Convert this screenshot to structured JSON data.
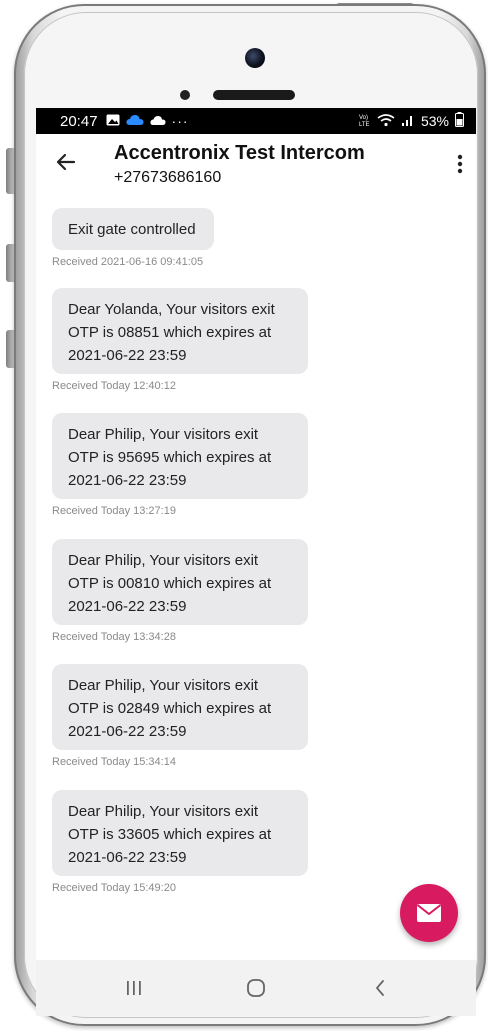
{
  "status_bar": {
    "time": "20:47",
    "battery": "53%",
    "left_icons": [
      "gallery-icon",
      "cloud-icon",
      "cloud-upload-icon",
      "more-icon"
    ],
    "right_icons": [
      "volte-icon",
      "wifi-icon",
      "signal-icon",
      "battery-icon"
    ],
    "volte_label": "Vo) LTE"
  },
  "header": {
    "title": "Accentronix Test Intercom",
    "phone_number": "+27673686160"
  },
  "messages": [
    {
      "lines": [
        "Exit gate controlled"
      ],
      "meta": "Received 2021-06-16 09:41:05"
    },
    {
      "lines": [
        "Dear Yolanda, Your visitors exit",
        "OTP is 08851 which expires at",
        "2021-06-22 23:59"
      ],
      "meta": "Received Today 12:40:12"
    },
    {
      "lines": [
        "Dear Philip, Your visitors exit",
        "OTP is 95695 which expires at",
        "2021-06-22 23:59"
      ],
      "meta": "Received Today 13:27:19"
    },
    {
      "lines": [
        "Dear Philip, Your visitors exit",
        "OTP is 00810 which expires at",
        "2021-06-22 23:59"
      ],
      "meta": "Received Today 13:34:28"
    },
    {
      "lines": [
        "Dear Philip, Your visitors exit",
        "OTP is 02849 which expires at",
        "2021-06-22 23:59"
      ],
      "meta": "Received Today 15:34:14"
    },
    {
      "lines": [
        "Dear Philip, Your visitors exit",
        "OTP is 33605 which expires at",
        "2021-06-22 23:59"
      ],
      "meta": "Received Today 15:49:20"
    }
  ],
  "fab": {
    "icon": "envelope-icon",
    "color": "#d81b60"
  },
  "nav": {
    "recents": "recents-icon",
    "home": "home-icon",
    "back": "back-icon"
  },
  "colors": {
    "bubble": "#e9e9ec",
    "meta_text": "#8a8a8a",
    "accent": "#d81b60"
  }
}
